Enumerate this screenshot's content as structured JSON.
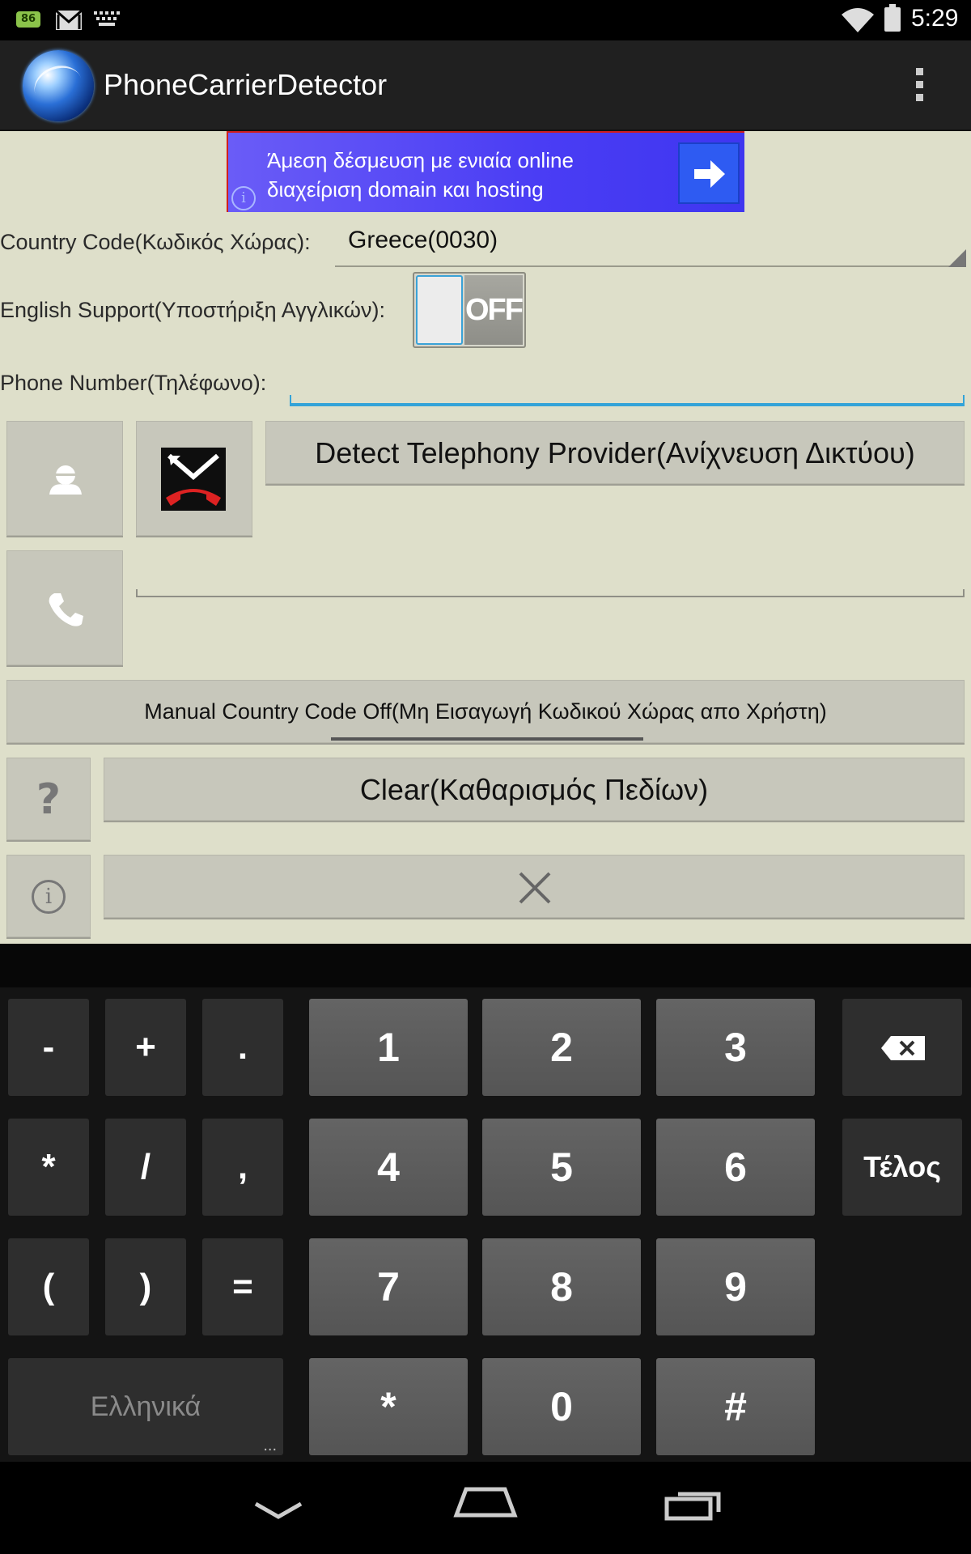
{
  "status_bar": {
    "battery_badge": "86",
    "time": "5:29"
  },
  "app": {
    "title": "PhoneCarrierDetector"
  },
  "ad": {
    "text_line1": "Άμεση δέσμευση με ενιαία online",
    "text_line2": "διαχείριση domain και hosting",
    "info_glyph": "i"
  },
  "form": {
    "country_label": "Country Code(Κωδικός Χώρας):",
    "country_value": "Greece(0030)",
    "english_label": "English Support(Υποστήριξη Αγγλικών):",
    "english_toggle": "OFF",
    "phone_label": "Phone Number(Τηλέφωνο):",
    "phone_value": ""
  },
  "buttons": {
    "detect": "Detect Telephony Provider(Ανίχνευση Δικτύου)",
    "manual_country": "Manual Country Code Off(Μη Εισαγωγή Κωδικού Χώρας απο Χρήστη)",
    "clear": "Clear(Καθαρισμός Πεδίων)",
    "help": "?",
    "info": "i"
  },
  "keyboard": {
    "symbol_keys": [
      "-",
      "+",
      ".",
      "*",
      "/",
      ",",
      "(",
      ")",
      "="
    ],
    "number_keys": [
      "1",
      "2",
      "3",
      "4",
      "5",
      "6",
      "7",
      "8",
      "9",
      "*",
      "0",
      "#"
    ],
    "done_label": "Τέλος",
    "language_label": "Ελληνικά",
    "language_more": "..."
  },
  "icons": {
    "contact": "contact-icon",
    "end_call": "end-call-icon",
    "call": "phone-icon",
    "close": "close-icon",
    "backspace": "backspace-icon",
    "nav_back": "back-icon",
    "nav_home": "home-icon",
    "nav_recents": "recents-icon"
  }
}
